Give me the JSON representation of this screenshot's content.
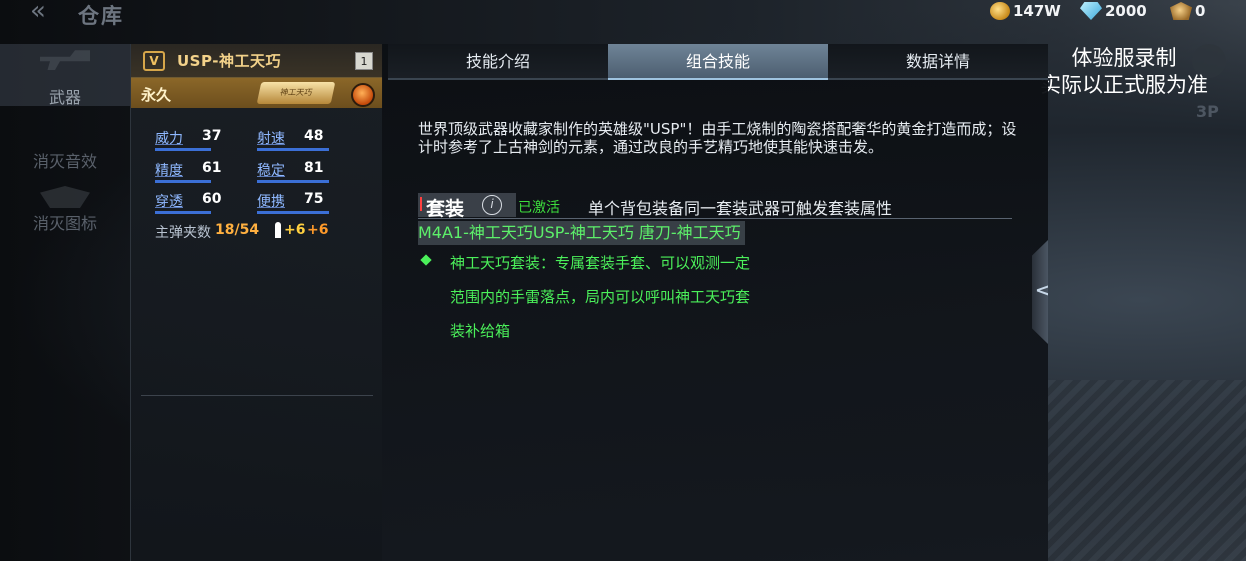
{
  "header": {
    "title": "仓库",
    "back_icon": "double-chevron-left-icon"
  },
  "currencies": [
    {
      "icon": "gold-coin-icon",
      "value": "147W"
    },
    {
      "icon": "diamond-icon",
      "value": "2000"
    },
    {
      "icon": "token-icon",
      "value": "0"
    }
  ],
  "watermark": {
    "line1": "体验服录制",
    "line2": "实际以正式服为准"
  },
  "sidebar": {
    "items": [
      {
        "label": "武器",
        "active": true
      },
      {
        "label": "消灭音效",
        "active": false
      },
      {
        "label": "消灭图标",
        "active": false
      }
    ]
  },
  "weapon": {
    "grade": "V",
    "name": "USP-神工天巧",
    "count": "1",
    "duration": "永久",
    "skin_tag": "神工天巧",
    "stats": [
      {
        "label": "威力",
        "value": "37"
      },
      {
        "label": "射速",
        "value": "48"
      },
      {
        "label": "精度",
        "value": "61"
      },
      {
        "label": "稳定",
        "value": "81"
      },
      {
        "label": "穿透",
        "value": "60"
      },
      {
        "label": "便携",
        "value": "75"
      }
    ],
    "magazine_label": "主弹夹数",
    "magazine_value": "18/54",
    "ammo_bonus_a": "+6",
    "ammo_bonus_b": "+6"
  },
  "tabs": [
    {
      "label": "技能介绍",
      "active": false
    },
    {
      "label": "组合技能",
      "active": true
    },
    {
      "label": "数据详情",
      "active": false
    }
  ],
  "description": "世界顶级武器收藏家制作的英雄级\"USP\"！由手工烧制的陶瓷搭配奢华的黄金打造而成；设计时参考了上古神剑的元素，通过改良的手艺精巧地使其能快速击发。",
  "set": {
    "title": "套装",
    "status": "已激活",
    "rule": "单个背包装备同一套装武器可触发套装属性",
    "members": "M4A1-神工天巧USP-神工天巧 唐刀-神工天巧",
    "bonus_lines": [
      "神工天巧套装：专属套装手套、可以观测一定",
      "范围内的手雷落点，局内可以呼叫神工天巧套",
      "装补给箱"
    ]
  },
  "misc": {
    "camera_mode": "3P",
    "panel_toggle_icon": "chevron-left-icon"
  }
}
